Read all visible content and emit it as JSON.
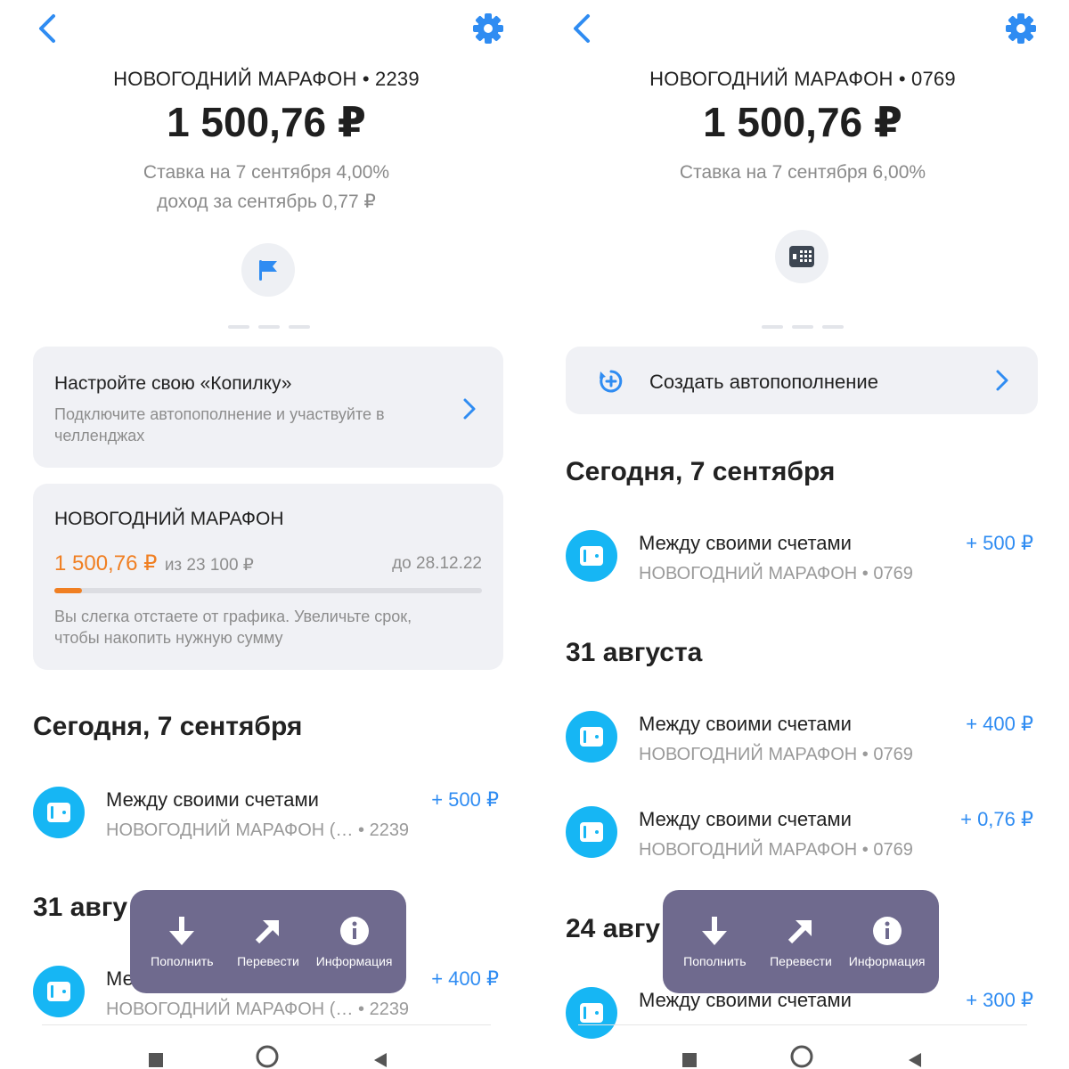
{
  "left": {
    "account_title": "НОВОГОДНИЙ МАРАФОН • 2239",
    "balance": "1 500,76 ₽",
    "rate": "Ставка на 7 сентября 4,00%",
    "income": "доход за сентябрь 0,77 ₽",
    "center_icon": "flag-icon",
    "promo": {
      "title": "Настройте свою «Копилку»",
      "subtitle_line1": "Подключите автопополнение и участвуйте в",
      "subtitle_line2": "челленджах"
    },
    "goal": {
      "title": "НОВОГОДНИЙ МАРАФОН",
      "current": "1 500,76 ₽",
      "of_target": "из 23 100 ₽",
      "deadline": "до 28.12.22",
      "progress": 0.065,
      "note_line1": "Вы слегка отстаете от графика. Увеличьте срок,",
      "note_line2": "чтобы накопить нужную сумму"
    },
    "sections": [
      {
        "heading": "Сегодня, 7 сентября",
        "transactions": [
          {
            "title": "Между своими счетами",
            "subtitle": "НОВОГОДНИЙ МАРАФОН (… • 2239",
            "amount": "+ 500 ₽"
          }
        ]
      },
      {
        "heading": "31 авгу",
        "transactions": [
          {
            "title": "Ме",
            "subtitle": "НОВОГОДНИЙ МАРАФОН (… • 2239",
            "amount": "+ 400 ₽"
          }
        ]
      }
    ]
  },
  "right": {
    "account_title": "НОВОГОДНИЙ МАРАФОН • 0769",
    "balance": "1 500,76 ₽",
    "rate": "Ставка на 7 сентября 6,00%",
    "center_icon": "deposit-icon",
    "autofill": {
      "label": "Создать автопополнение"
    },
    "sections": [
      {
        "heading": "Сегодня, 7 сентября",
        "transactions": [
          {
            "title": "Между своими счетами",
            "subtitle": "НОВОГОДНИЙ МАРАФОН • 0769",
            "amount": "+ 500 ₽"
          }
        ]
      },
      {
        "heading": "31 августа",
        "transactions": [
          {
            "title": "Между своими счетами",
            "subtitle": "НОВОГОДНИЙ МАРАФОН • 0769",
            "amount": "+ 400 ₽"
          },
          {
            "title": "Между своими счетами",
            "subtitle": "НОВОГОДНИЙ МАРАФОН • 0769",
            "amount": "+ 0,76 ₽"
          }
        ]
      },
      {
        "heading": "24 авгу",
        "transactions": [
          {
            "title": "Между своими счетами",
            "subtitle": "",
            "amount": "+ 300 ₽"
          }
        ]
      }
    ]
  },
  "actions": [
    {
      "label": "Пополнить",
      "icon": "arrow-down-icon"
    },
    {
      "label": "Перевести",
      "icon": "arrow-up-right-icon"
    },
    {
      "label": "Информация",
      "icon": "info-icon"
    }
  ],
  "colors": {
    "accent": "#2f8cf2",
    "goal_amount": "#f07f22",
    "tx_icon": "#16b6f4",
    "action_bar": "#6f6a8e",
    "card_bg": "#f0f1f5"
  }
}
